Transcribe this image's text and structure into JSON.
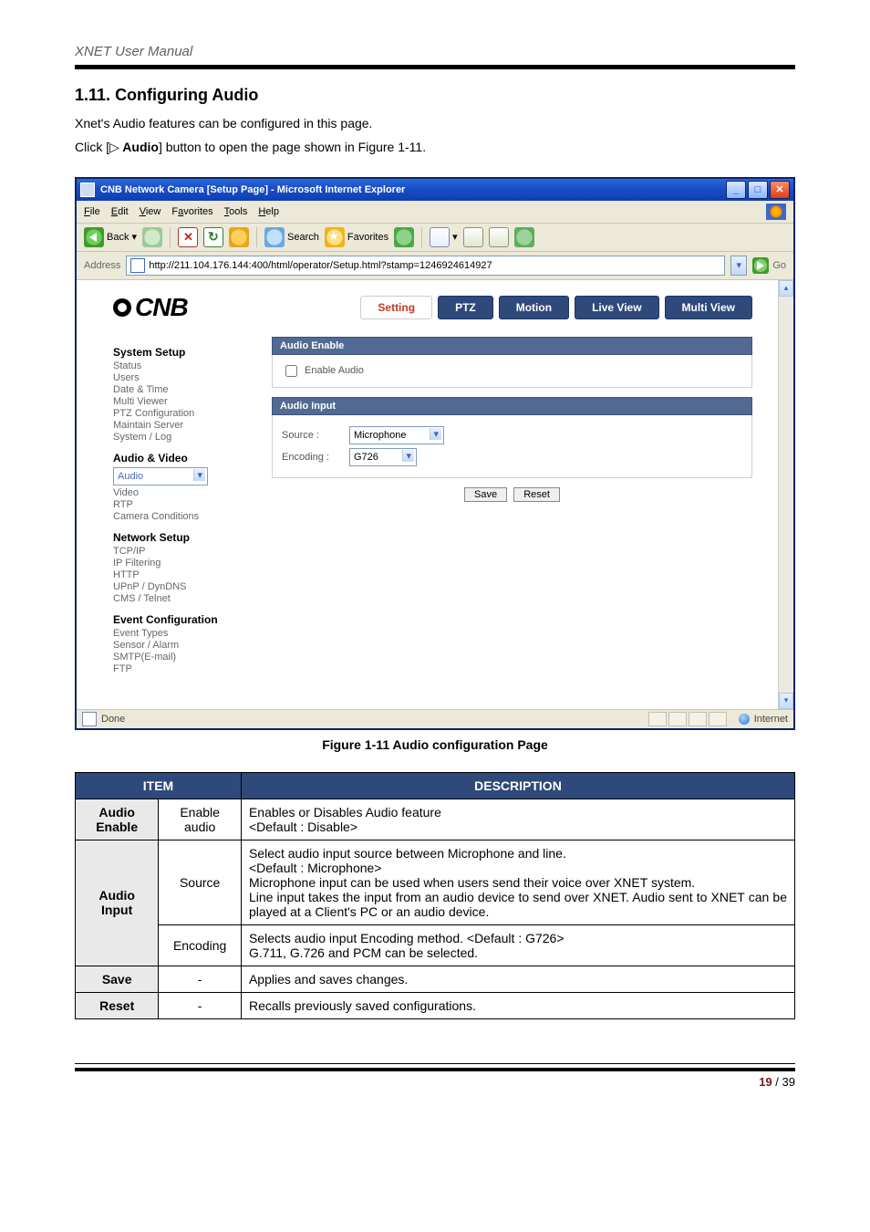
{
  "doc": {
    "running_head": "XNET User Manual",
    "section_number": "1.11.",
    "section_title": "Configuring Audio",
    "intro_line": "Xnet's Audio features can be configured in this page.",
    "click_prefix": "Click [",
    "click_icon": "▷",
    "click_bold": " Audio",
    "click_suffix": "] button to open the page shown in Figure 1-11.",
    "figure_caption": "Figure 1-11 Audio configuration Page",
    "page_current": "19",
    "page_sep": " / ",
    "page_total": "39"
  },
  "ie": {
    "title": "CNB Network Camera [Setup Page] - Microsoft Internet Explorer",
    "menu": {
      "file": "File",
      "edit": "Edit",
      "view": "View",
      "favorites": "Favorites",
      "tools": "Tools",
      "help": "Help"
    },
    "toolbar": {
      "back": "Back",
      "search": "Search",
      "favorites": "Favorites"
    },
    "addr_label": "Address",
    "addr_value": "http://211.104.176.144:400/html/operator/Setup.html?stamp=1246924614927",
    "go": "Go",
    "status_done": "Done",
    "status_zone": "Internet"
  },
  "setup": {
    "brand": "CNB",
    "tabs": {
      "setting": "Setting",
      "ptz": "PTZ",
      "motion": "Motion",
      "live": "Live View",
      "multi": "Multi View"
    },
    "side": {
      "g1": "System Setup",
      "g1_items": [
        "Status",
        "Users",
        "Date & Time",
        "Multi Viewer",
        "PTZ Configuration",
        "Maintain Server",
        "System / Log"
      ],
      "g2": "Audio & Video",
      "g2_items": [
        "Audio",
        "Video",
        "RTP",
        "Camera Conditions"
      ],
      "g3": "Network Setup",
      "g3_items": [
        "TCP/IP",
        "IP Filtering",
        "HTTP",
        "UPnP / DynDNS",
        "CMS / Telnet"
      ],
      "g4": "Event Configuration",
      "g4_items": [
        "Event Types",
        "Sensor / Alarm",
        "SMTP(E-mail)",
        "FTP"
      ]
    },
    "panel": {
      "hdr1": "Audio Enable",
      "enable_label": "Enable Audio",
      "hdr2": "Audio Input",
      "source_label": "Source :",
      "source_value": "Microphone",
      "encoding_label": "Encoding :",
      "encoding_value": "G726",
      "save": "Save",
      "reset": "Reset"
    }
  },
  "table": {
    "head_item": "ITEM",
    "head_desc": "DESCRIPTION",
    "r1_a": "Audio Enable",
    "r1_b": "Enable audio",
    "r1_c": "Enables or Disables Audio feature\n<Default : Disable>",
    "r2_a": "Audio Input",
    "r2_b": "Source",
    "r2_c": "Select audio input source between Microphone and line.\n<Default : Microphone>\nMicrophone input can be used when users send their voice over XNET system.\nLine input takes the input from an audio device to send over XNET. Audio sent to XNET can be played at a Client's PC or an audio device.",
    "r3_b": "Encoding",
    "r3_c": "Selects audio input Encoding method. <Default : G726>\nG.711, G.726 and PCM can be selected.",
    "r4_a": "Save",
    "r4_b": "-",
    "r4_c": "Applies and saves changes.",
    "r5_a": "Reset",
    "r5_b": "-",
    "r5_c": "Recalls previously saved configurations."
  }
}
